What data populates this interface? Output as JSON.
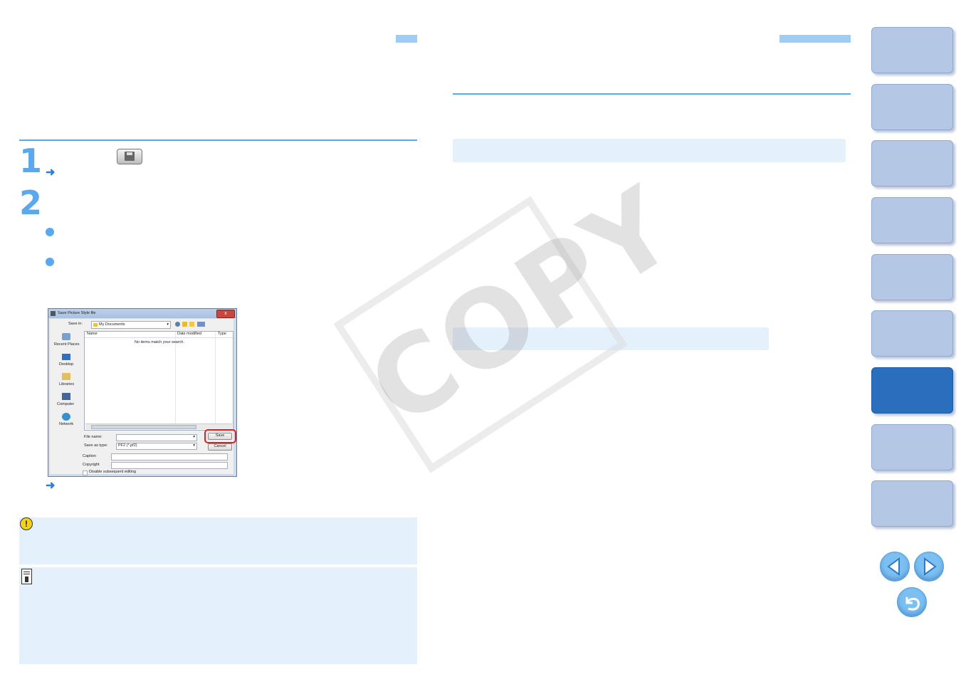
{
  "steps": [
    {
      "number": "1"
    },
    {
      "number": "2"
    }
  ],
  "arrow_glyph": "➜",
  "dialog": {
    "title": "Save Picture Style file",
    "save_in_label": "Save in:",
    "save_in_value": "My Documents",
    "places": [
      "Recent Places",
      "Desktop",
      "Libraries",
      "Computer",
      "Network"
    ],
    "columns": [
      "Name",
      "Date modified",
      "Type"
    ],
    "empty_message": "No items match your search.",
    "file_name_label": "File name:",
    "save_as_type_label": "Save as type:",
    "save_as_type_value": "PF2 (*.pf2)",
    "save_button": "Save",
    "cancel_button": "Cancel",
    "caption_label": "Caption",
    "copyright_label": "Copyright",
    "disable_checkbox_label": "Disable subsequent editing",
    "close_glyph": "x"
  },
  "watermark": "COPY",
  "colors": {
    "accent": "#5aa8ee",
    "panel": "#e4f0fc",
    "nav_active": "#2a6fbd",
    "nav": "#b4c8e6"
  }
}
